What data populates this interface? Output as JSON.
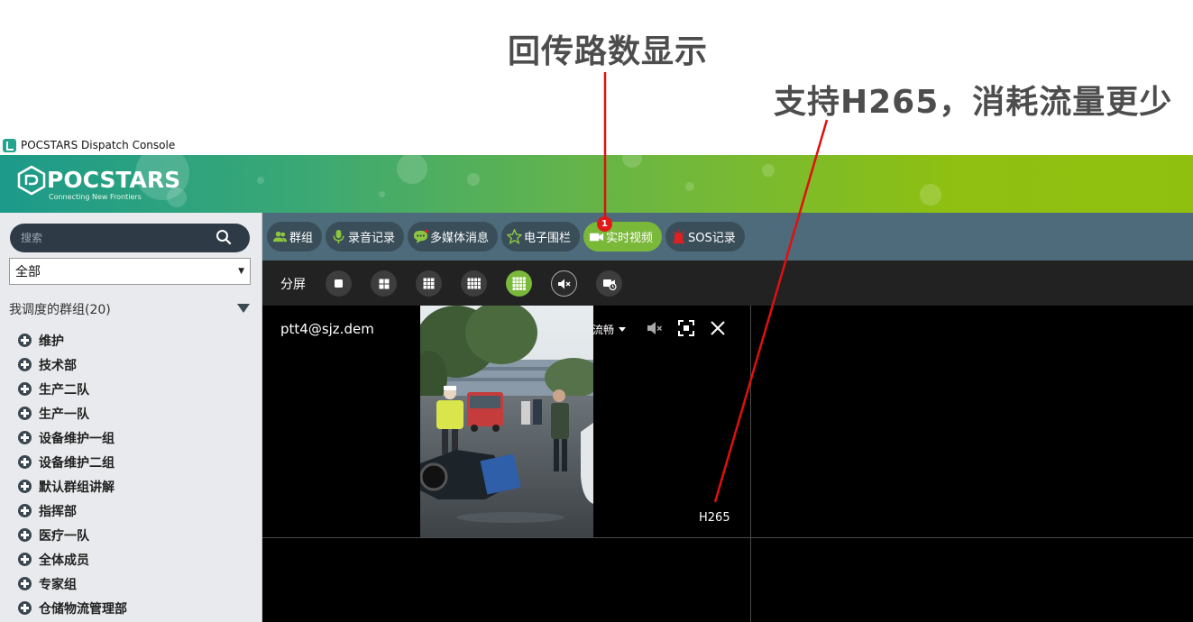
{
  "annotations": {
    "callout_1": "回传路数显示",
    "callout_2": "支持H265，消耗流量更少",
    "line_color": "#e01010"
  },
  "window": {
    "title": "POCSTARS Dispatch Console"
  },
  "banner": {
    "logo_text": "POCSTARS",
    "tagline": "Connecting New Frontiers",
    "gradient_start": "#1c9a8a",
    "gradient_end": "#90c00f"
  },
  "sidebar": {
    "search_placeholder": "搜索",
    "filter_value": "全部",
    "groups_header": "我调度的群组(20)",
    "groups": [
      "维护",
      "技术部",
      "生产二队",
      "生产一队",
      "设备维护一组",
      "设备维护二组",
      "默认群组讲解",
      "指挥部",
      "医疗一队",
      "全体成员",
      "专家组",
      "仓储物流管理部"
    ]
  },
  "toolbar": {
    "group": "群组",
    "recordings": "录音记录",
    "multimedia": "多媒体消息",
    "geofence": "电子围栏",
    "live_video": "实时视频",
    "live_video_badge": "1",
    "sos": "SOS记录",
    "active_color": "#7ab83a"
  },
  "split_bar": {
    "label": "分屏"
  },
  "video": {
    "channel_label": "ptt4@sjz.dem",
    "quality": "流畅",
    "codec": "H265"
  }
}
